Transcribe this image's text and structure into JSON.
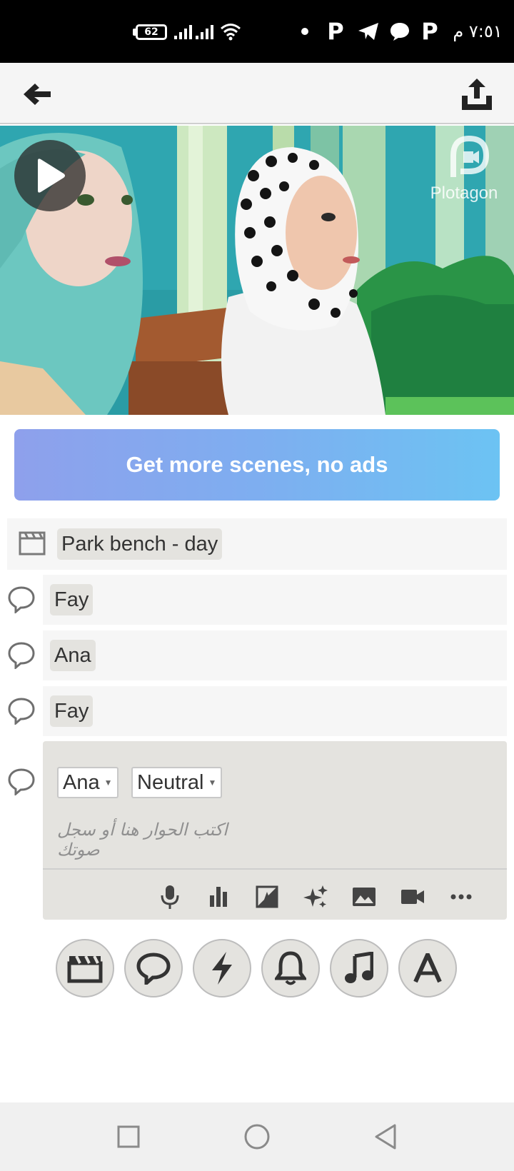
{
  "status_bar": {
    "battery_level": "62",
    "time": "٧:٥١ م",
    "app_notification_letters": [
      "P",
      "P",
      "P"
    ]
  },
  "app_bar": {
    "back_icon": "arrow-left-icon",
    "share_icon": "share-upload-icon"
  },
  "scene": {
    "watermark_text": "Plotagon",
    "play_icon": "play-icon"
  },
  "promo": {
    "label": "Get more scenes, no ads"
  },
  "script": {
    "scene_row": {
      "label": "Park bench - day",
      "icon": "clapperboard-icon"
    },
    "dialogue_rows": [
      {
        "character": "Fay"
      },
      {
        "character": "Ana"
      },
      {
        "character": "Fay"
      }
    ],
    "editor": {
      "character_select": "Ana",
      "emotion_select": "Neutral",
      "placeholder": "اكتب الحوار هنا أو سجل صوتك",
      "tools": [
        "microphone-icon",
        "bar-chart-icon",
        "contrast-icon",
        "sparkles-icon",
        "image-icon",
        "video-camera-icon",
        "more-icon"
      ]
    }
  },
  "add_buttons": [
    "clapperboard-icon",
    "speech-bubble-icon",
    "lightning-icon",
    "bell-icon",
    "music-note-icon",
    "text-a-icon"
  ],
  "nav_bar": [
    "recents-square-icon",
    "home-circle-icon",
    "back-triangle-icon"
  ],
  "colors": {
    "promo_gradient_start": "#8ea0ec",
    "promo_gradient_end": "#6cc3f3",
    "chip_background": "#e4e3df",
    "scene_teal": "#2b9aa3"
  }
}
